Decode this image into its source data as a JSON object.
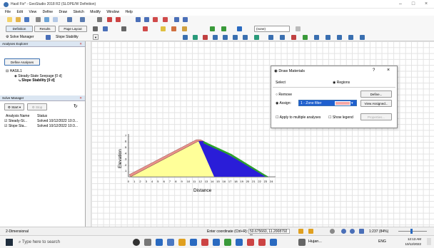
{
  "window": {
    "title": "Hasil Fix* - GeoStudio 2018 R2 (SLOPE/W Definition)"
  },
  "menu": [
    "File",
    "Edit",
    "View",
    "Define",
    "Draw",
    "Sketch",
    "Modify",
    "Window",
    "Help"
  ],
  "toolbar2": {
    "definition": "Definition",
    "results": "Results",
    "page_layout": "Page Layout",
    "none_select": "(none)"
  },
  "toolbar3": {
    "solve_manager": "Solve Manager",
    "slope_stability": "Slope Stability"
  },
  "analyses_explorer": {
    "title": "Analyses Explorer",
    "define_btn": "Define Analyses",
    "root": "HASIL1",
    "child1": "Steady-State Seepage [0 d]",
    "child2": "Slope Stability [0 d]"
  },
  "solve_manager": {
    "title": "Solve Manager",
    "start": "Start",
    "stop": "Stop",
    "col_name": "Analysis Name",
    "col_status": "Status",
    "rows": [
      {
        "name": "Steady-St...",
        "status": "Solved 10/12/2022 10:3..."
      },
      {
        "name": "Slope Sta...",
        "status": "Solved 10/12/2022 10:3..."
      }
    ]
  },
  "chart_data": {
    "type": "diagram",
    "xlabel": "Distance",
    "ylabel": "Elevation",
    "x_ticks": [
      "0",
      "1",
      "2",
      "3",
      "4",
      "5",
      "6",
      "7",
      "8",
      "9",
      "10",
      "11",
      "12",
      "13",
      "14",
      "15",
      "16",
      "17",
      "18",
      "19",
      "20",
      "21",
      "22",
      "23",
      "24"
    ],
    "y_ticks": [
      "1",
      "2",
      "3",
      "4",
      "5",
      "6",
      "7"
    ]
  },
  "dialog": {
    "title": "Draw Materials",
    "help": "?",
    "close": "×",
    "select_label": "Select",
    "regions": "Regions",
    "remove": "Remove",
    "assign": "Assign:",
    "material": "1 - Zone filter",
    "material_color": "#f4a6a6",
    "define_btn": "Define...",
    "view_assigned": "View Assigned...",
    "apply_multi": "Apply to multiple analyses",
    "show_legend": "Show legend",
    "properties": "Properties..."
  },
  "status": {
    "mode": "2-Dimensional",
    "coord_label": "Enter coordinate (Ctrl+R):",
    "coord_value": "50.675660, 11.2008792 m",
    "scale": "1:237 (84%)"
  },
  "taskbar": {
    "search": "Type here to search",
    "weather": "Hujan...",
    "lang": "ENG",
    "time": "12:13 AM",
    "date": "10/12/2022"
  },
  "colors": {
    "yellow": "#ffff99",
    "blue": "#2a1dd8",
    "green": "#2ca02c",
    "pink": "#e8918a"
  }
}
